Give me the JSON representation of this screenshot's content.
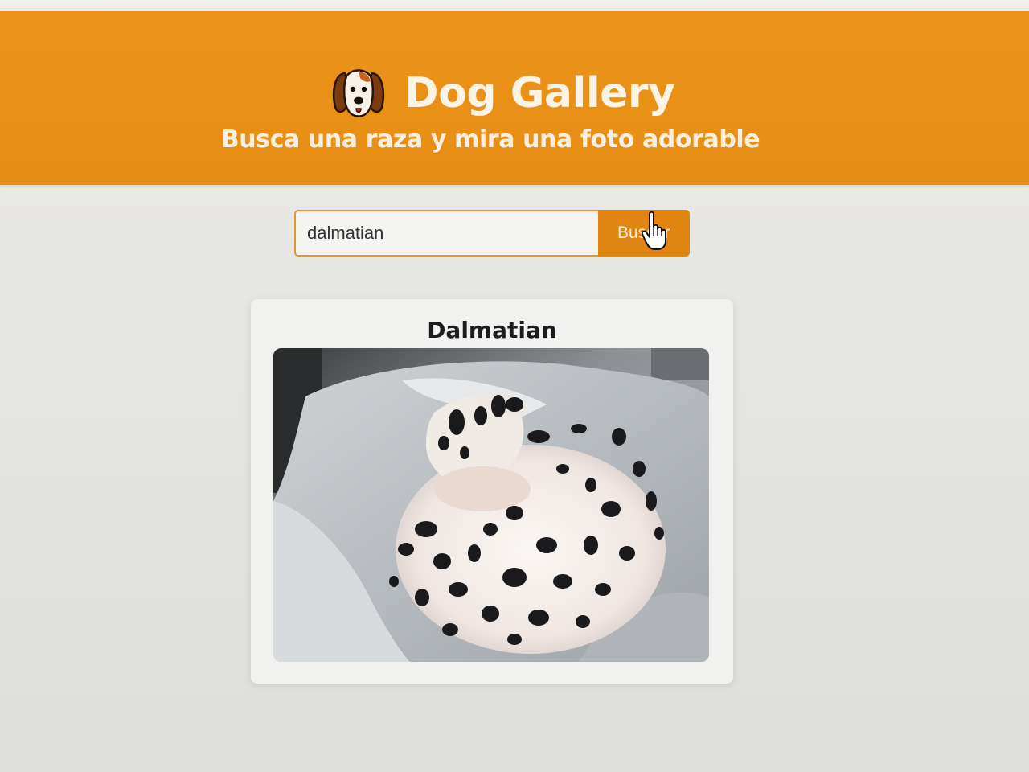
{
  "header": {
    "title": "Dog Gallery",
    "subtitle": "Busca una raza y mira una foto adorable",
    "logo_icon": "dog-face-icon",
    "background_color": "#ea921a"
  },
  "search": {
    "value": "dalmatian",
    "button_label": "Buscar",
    "accent_color": "#e08510"
  },
  "result": {
    "breed_name": "Dalmatian",
    "photo_alt": "Dalmatian dog curled up sleeping on a white blanket"
  }
}
